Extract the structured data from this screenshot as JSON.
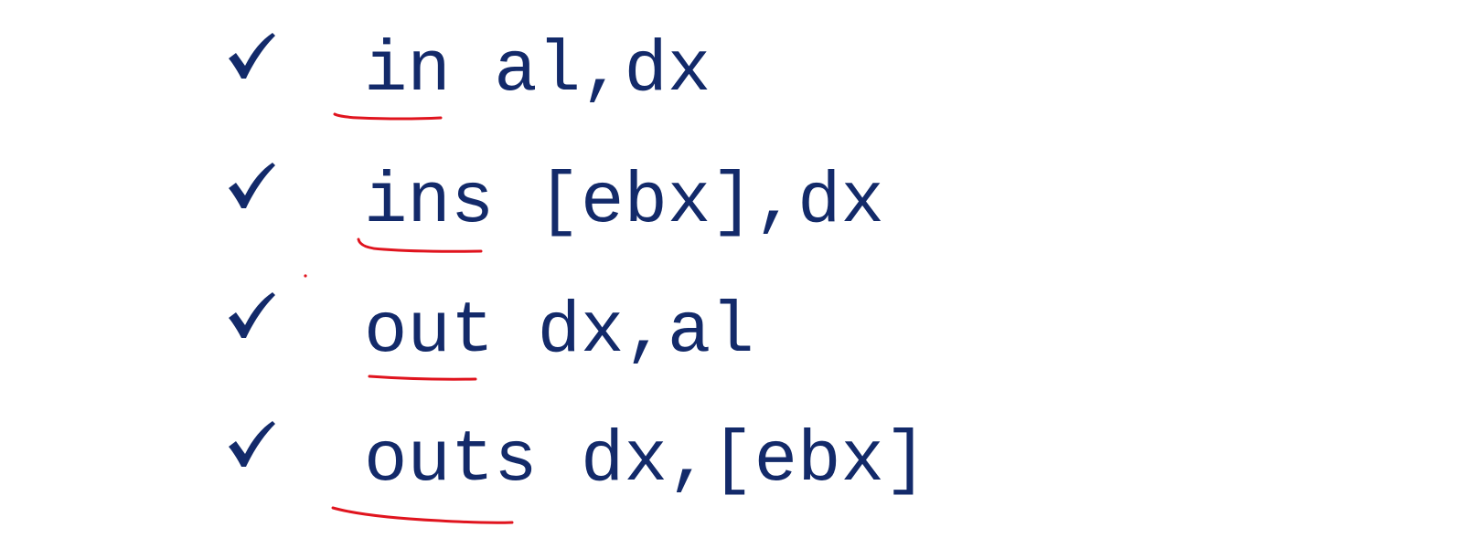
{
  "slide": {
    "lines": [
      {
        "mnemonic": "in",
        "operands": " al,dx"
      },
      {
        "mnemonic": "ins",
        "operands": " [ebx],dx"
      },
      {
        "mnemonic": "out",
        "operands": " dx,al"
      },
      {
        "mnemonic": "outs",
        "operands": " dx,[ebx]"
      }
    ]
  },
  "colors": {
    "text": "#132a6a",
    "check": "#132a6a",
    "annotation": "#e0141e"
  },
  "icons": {
    "bullet": "check-icon"
  }
}
